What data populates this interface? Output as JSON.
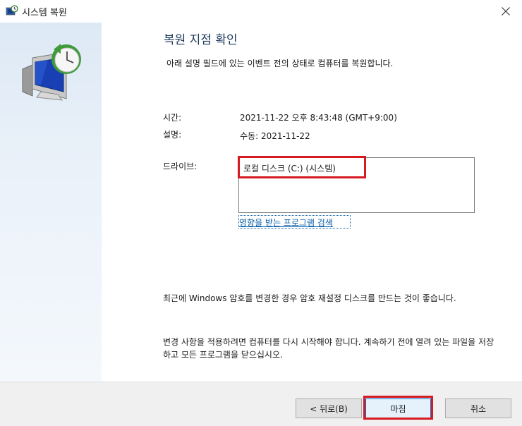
{
  "window": {
    "title": "시스템 복원"
  },
  "heading": "복원 지점 확인",
  "subtitle": "아래 설명 필드에 있는 이벤트 전의 상태로 컴퓨터를 복원합니다.",
  "details": {
    "time_label": "시간:",
    "time_value": "2021-11-22 오후 8:43:48 (GMT+9:00)",
    "desc_label": "설명:",
    "desc_value": "수동: 2021-11-22",
    "drives_label": "드라이브:",
    "drives": [
      "로컬 디스크 (C:) (시스템)"
    ]
  },
  "scan_link": "영향을 받는 프로그램 검색",
  "password_note": "최근에 Windows 암호를 변경한 경우 암호 재설정 디스크를 만드는 것이 좋습니다.",
  "restart_note": "변경 사항을 적용하려면 컴퓨터를 다시 시작해야 합니다. 계속하기 전에 열려 있는 파일을 저장하고 모든 프로그램을 닫으십시오.",
  "buttons": {
    "back": "< 뒤로(B)",
    "finish": "마침",
    "cancel": "취소"
  },
  "colors": {
    "highlight": "#d71920",
    "heading": "#1e395b",
    "link": "#0a5fa8"
  },
  "icons": {
    "title": "system-restore-icon",
    "sidebar": "system-restore-monitor-clock-icon",
    "close": "close-icon"
  }
}
